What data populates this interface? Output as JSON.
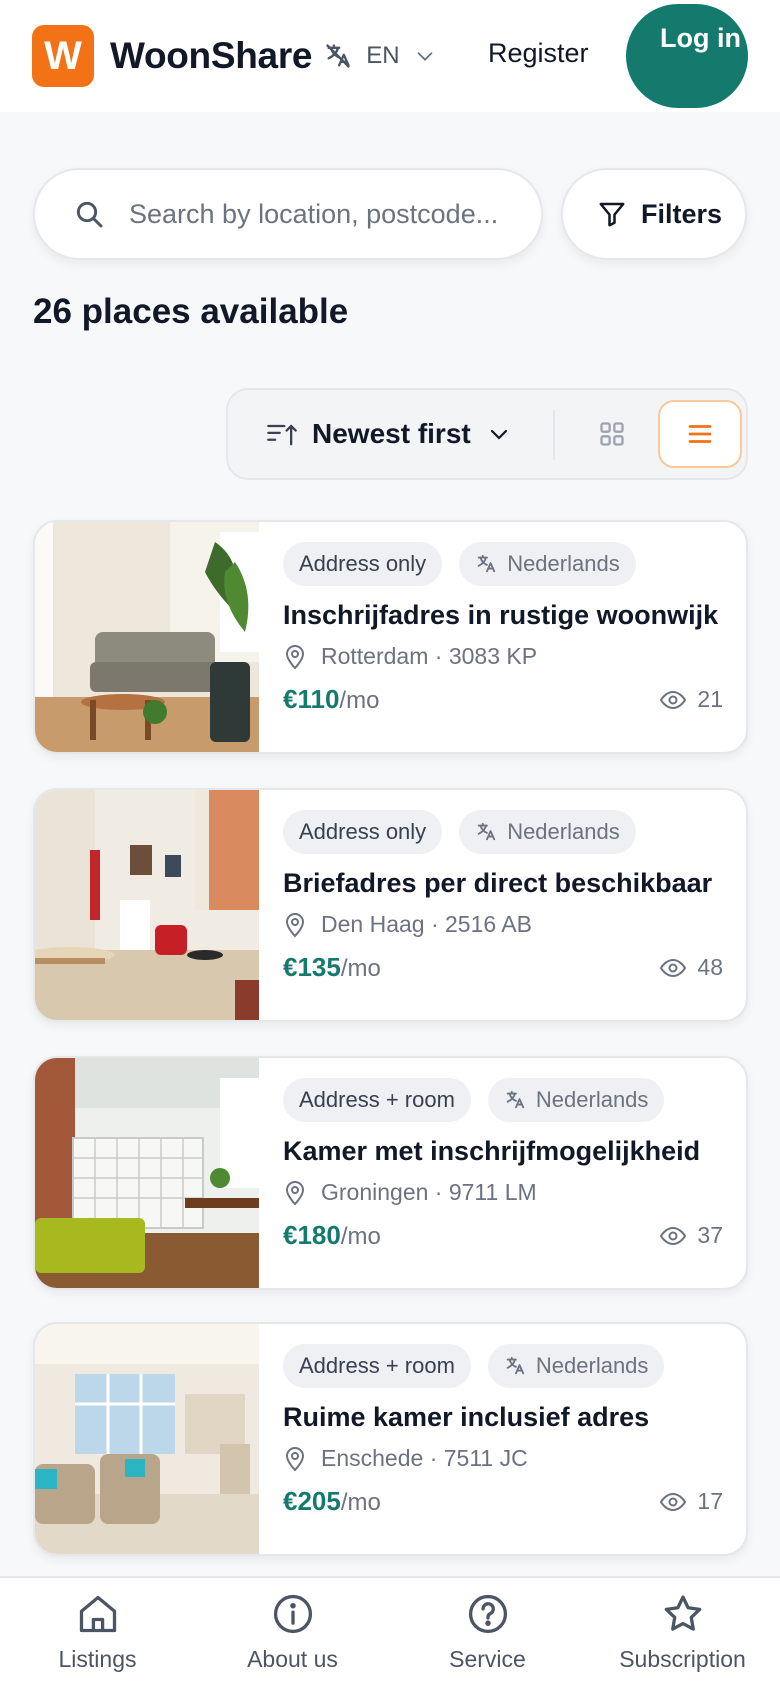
{
  "header": {
    "logo_letter": "W",
    "brand": "WoonShare",
    "language_code": "EN",
    "register_label": "Register",
    "login_label": "Log in"
  },
  "search": {
    "placeholder": "Search by location, postcode...",
    "filters_label": "Filters"
  },
  "results": {
    "count_label": "26 places available"
  },
  "sort": {
    "label": "Newest first",
    "view_mode": "list"
  },
  "listings": [
    {
      "type": "Address only",
      "language": "Nederlands",
      "title": "Inschrijfadres in rustige woonwijk",
      "location": "Rotterdam · 3083 KP",
      "price": "€110",
      "per": "/mo",
      "views": "21"
    },
    {
      "type": "Address only",
      "language": "Nederlands",
      "title": "Briefadres per direct beschikbaar",
      "location": "Den Haag · 2516 AB",
      "price": "€135",
      "per": "/mo",
      "views": "48"
    },
    {
      "type": "Address + room",
      "language": "Nederlands",
      "title": "Kamer met inschrijfmogelijkheid",
      "location": "Groningen · 9711 LM",
      "price": "€180",
      "per": "/mo",
      "views": "37"
    },
    {
      "type": "Address + room",
      "language": "Nederlands",
      "title": "Ruime kamer inclusief adres",
      "location": "Enschede · 7511 JC",
      "price": "€205",
      "per": "/mo",
      "views": "17"
    }
  ],
  "bottom_nav": [
    {
      "label": "Listings",
      "icon": "home-icon"
    },
    {
      "label": "About us",
      "icon": "info-icon"
    },
    {
      "label": "Service",
      "icon": "help-icon"
    },
    {
      "label": "Subscription",
      "icon": "star-icon"
    }
  ],
  "colors": {
    "brand_orange": "#f47216",
    "accent_teal": "#157a6e"
  }
}
